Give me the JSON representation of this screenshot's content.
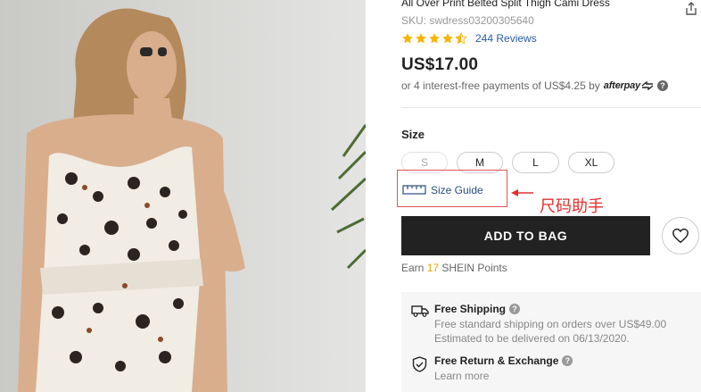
{
  "product": {
    "title": "All Over Print Belted Split Thigh Cami Dress",
    "sku": "SKU: swdress03200305640",
    "rating": 4.5,
    "reviews": "244 Reviews",
    "price": "US$17.00",
    "afterpay_text": "or 4 interest-free payments of US$4.25 by",
    "afterpay_brand": "afterpay"
  },
  "size": {
    "label": "Size",
    "options": [
      "S",
      "M",
      "L",
      "XL"
    ],
    "guide_label": "Size Guide"
  },
  "annotation": {
    "text": "尺码助手"
  },
  "actions": {
    "add_to_bag": "ADD TO BAG"
  },
  "points": {
    "prefix": "Earn",
    "count": "17",
    "suffix": "SHEIN Points"
  },
  "perks": {
    "shipping_title": "Free Shipping",
    "shipping_line1": "Free standard shipping on orders over US$49.00",
    "shipping_line2": "Estimated to be delivered on 06/13/2020.",
    "return_title": "Free Return & Exchange",
    "return_link": "Learn more"
  },
  "colors": {
    "accent": "#222222",
    "star": "#f7b500",
    "annotation": "#e03030",
    "link": "#2a5d9f"
  }
}
